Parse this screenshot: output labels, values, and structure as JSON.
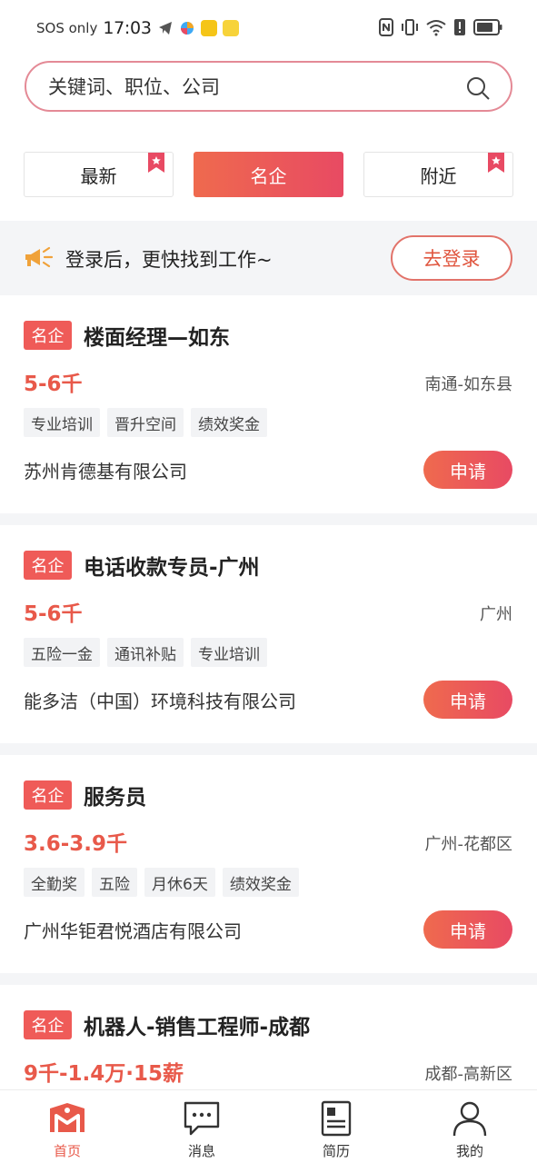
{
  "status_bar": {
    "carrier": "SOS only",
    "time": "17:03"
  },
  "search": {
    "placeholder": "关键词、职位、公司"
  },
  "filter_tabs": [
    {
      "label": "最新",
      "bookmarked": true,
      "active": false
    },
    {
      "label": "名企",
      "bookmarked": false,
      "active": true
    },
    {
      "label": "附近",
      "bookmarked": true,
      "active": false
    }
  ],
  "login_banner": {
    "text": "登录后，更快找到工作~",
    "button_label": "去登录"
  },
  "jobs": [
    {
      "badge": "名企",
      "title": "楼面经理—如东",
      "salary": "5-6千",
      "location": "南通-如东县",
      "tags": [
        "专业培训",
        "晋升空间",
        "绩效奖金"
      ],
      "company": "苏州肯德基有限公司",
      "apply_label": "申请"
    },
    {
      "badge": "名企",
      "title": "电话收款专员-广州",
      "salary": "5-6千",
      "location": "广州",
      "tags": [
        "五险一金",
        "通讯补贴",
        "专业培训"
      ],
      "company": "能多洁（中国）环境科技有限公司",
      "apply_label": "申请"
    },
    {
      "badge": "名企",
      "title": "服务员",
      "salary": "3.6-3.9千",
      "location": "广州-花都区",
      "tags": [
        "全勤奖",
        "五险",
        "月休6天",
        "绩效奖金"
      ],
      "company": "广州华钜君悦酒店有限公司",
      "apply_label": "申请"
    },
    {
      "badge": "名企",
      "title": "机器人-销售工程师-成都",
      "salary": "9千-1.4万·15薪",
      "location": "成都-高新区",
      "tags": [],
      "company": "",
      "apply_label": ""
    }
  ],
  "bottom_nav": [
    {
      "label": "首页",
      "icon": "home-icon",
      "active": true
    },
    {
      "label": "消息",
      "icon": "message-icon",
      "active": false
    },
    {
      "label": "简历",
      "icon": "resume-icon",
      "active": false
    },
    {
      "label": "我的",
      "icon": "profile-icon",
      "active": false
    }
  ],
  "colors": {
    "accent": "#e8594a",
    "accent_gradient_start": "#ef6a4e",
    "accent_gradient_end": "#e84a63",
    "badge": "#ef5b58",
    "search_border": "#e48a96",
    "section_bg": "#f4f5f7"
  }
}
